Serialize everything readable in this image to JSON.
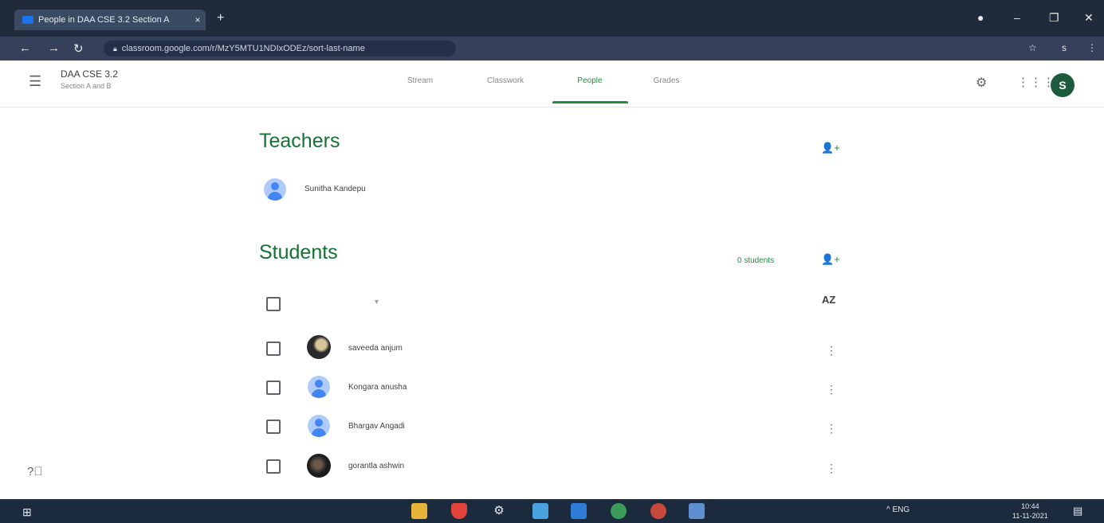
{
  "browser": {
    "tab_title": "People in DAA CSE 3.2 Section A",
    "tab_close": "×",
    "new_tab": "+",
    "url": "classroom.google.com/r/MzY5MTU1NDIxODEz/sort-last-name",
    "window_controls": {
      "minimize": "–",
      "restore": "❐",
      "close": "✕"
    },
    "profile_initial": "s"
  },
  "header": {
    "class_name": "DAA CSE 3.2",
    "class_section": "Section A and B",
    "tabs": [
      {
        "label": "Stream"
      },
      {
        "label": "Classwork"
      },
      {
        "label": "People"
      },
      {
        "label": "Grades"
      }
    ],
    "active_tab": "People",
    "avatar_initial": "S"
  },
  "teachers": {
    "title": "Teachers",
    "list": [
      {
        "name": "Sunitha Kandepu"
      }
    ]
  },
  "students": {
    "title": "Students",
    "count": "0 students",
    "actions_caret": "▾",
    "sort_label": "AZ",
    "list": [
      {
        "name": "saveeda anjum",
        "avatar": "photo"
      },
      {
        "name": "Kongara anusha",
        "avatar": "default"
      },
      {
        "name": "Bhargav Angadi",
        "avatar": "default"
      },
      {
        "name": "gorantla ashwin",
        "avatar": "photo"
      }
    ]
  },
  "taskbar": {
    "tray_text": "^ ENG",
    "time": "10:44",
    "date": "11-11-2021"
  },
  "colors": {
    "accent_green": "#1e8e3e",
    "title_green": "#137333",
    "avatar_bg": "#1e5a3c"
  }
}
